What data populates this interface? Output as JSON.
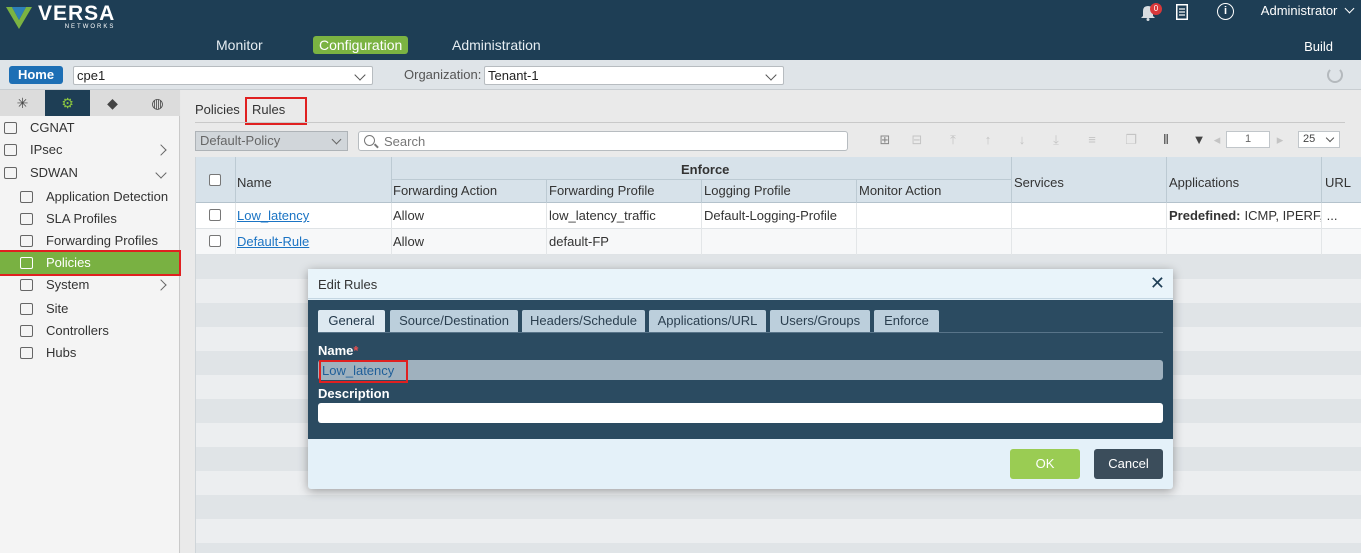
{
  "brand": {
    "name": "VERSA",
    "sub": "NETWORKS"
  },
  "nav": {
    "items": [
      "Monitor",
      "Configuration",
      "Administration"
    ],
    "active": "Configuration",
    "build": "Build"
  },
  "top": {
    "notifications": "0",
    "user": "Administrator"
  },
  "subbar": {
    "home": "Home",
    "device": "cpe1",
    "org_label": "Organization:",
    "org": "Tenant-1"
  },
  "sidebar": {
    "items": [
      {
        "label": "CGNAT",
        "icon": "cgnat-icon",
        "indent": false,
        "expand": false
      },
      {
        "label": "IPsec",
        "icon": "ipsec-icon",
        "indent": false,
        "expand": true
      },
      {
        "label": "SDWAN",
        "icon": "sdwan-icon",
        "indent": false,
        "expand": true
      },
      {
        "label": "Application Detection",
        "icon": "app-detect-icon",
        "indent": true,
        "expand": false
      },
      {
        "label": "SLA Profiles",
        "icon": "sla-icon",
        "indent": true,
        "expand": false
      },
      {
        "label": "Forwarding Profiles",
        "icon": "fwd-profile-icon",
        "indent": true,
        "expand": false
      },
      {
        "label": "Policies",
        "icon": "policy-icon",
        "indent": true,
        "expand": false
      },
      {
        "label": "System",
        "icon": "system-icon",
        "indent": true,
        "expand": true
      },
      {
        "label": "Site",
        "icon": "site-icon",
        "indent": true,
        "expand": false
      },
      {
        "label": "Controllers",
        "icon": "controllers-icon",
        "indent": true,
        "expand": false
      },
      {
        "label": "Hubs",
        "icon": "hubs-icon",
        "indent": true,
        "expand": false
      }
    ]
  },
  "main": {
    "tabs": [
      "Policies",
      "Rules"
    ],
    "policy": "Default-Policy",
    "search_placeholder": "Search",
    "page": "1",
    "page_size": "25"
  },
  "table": {
    "group": "Enforce",
    "headers": {
      "name": "Name",
      "fwd_action": "Forwarding Action",
      "fwd_profile": "Forwarding Profile",
      "log_profile": "Logging Profile",
      "monitor": "Monitor Action",
      "services": "Services",
      "apps": "Applications",
      "url": "URL"
    },
    "rows": [
      {
        "name": "Low_latency",
        "fwd_action": "Allow",
        "fwd_profile": "low_latency_traffic",
        "log_profile": "Default-Logging-Profile",
        "apps_label": "Predefined:",
        "apps": "ICMP, IPERF, ..."
      },
      {
        "name": "Default-Rule",
        "fwd_action": "Allow",
        "fwd_profile": "default-FP",
        "log_profile": "",
        "apps_label": "",
        "apps": ""
      }
    ]
  },
  "modal": {
    "title": "Edit Rules",
    "tabs": [
      "General",
      "Source/Destination",
      "Headers/Schedule",
      "Applications/URL",
      "Users/Groups",
      "Enforce"
    ],
    "name_label": "Name",
    "required": "*",
    "name_value": "Low_latency",
    "desc_label": "Description",
    "desc_value": "",
    "ok": "OK",
    "cancel": "Cancel"
  }
}
